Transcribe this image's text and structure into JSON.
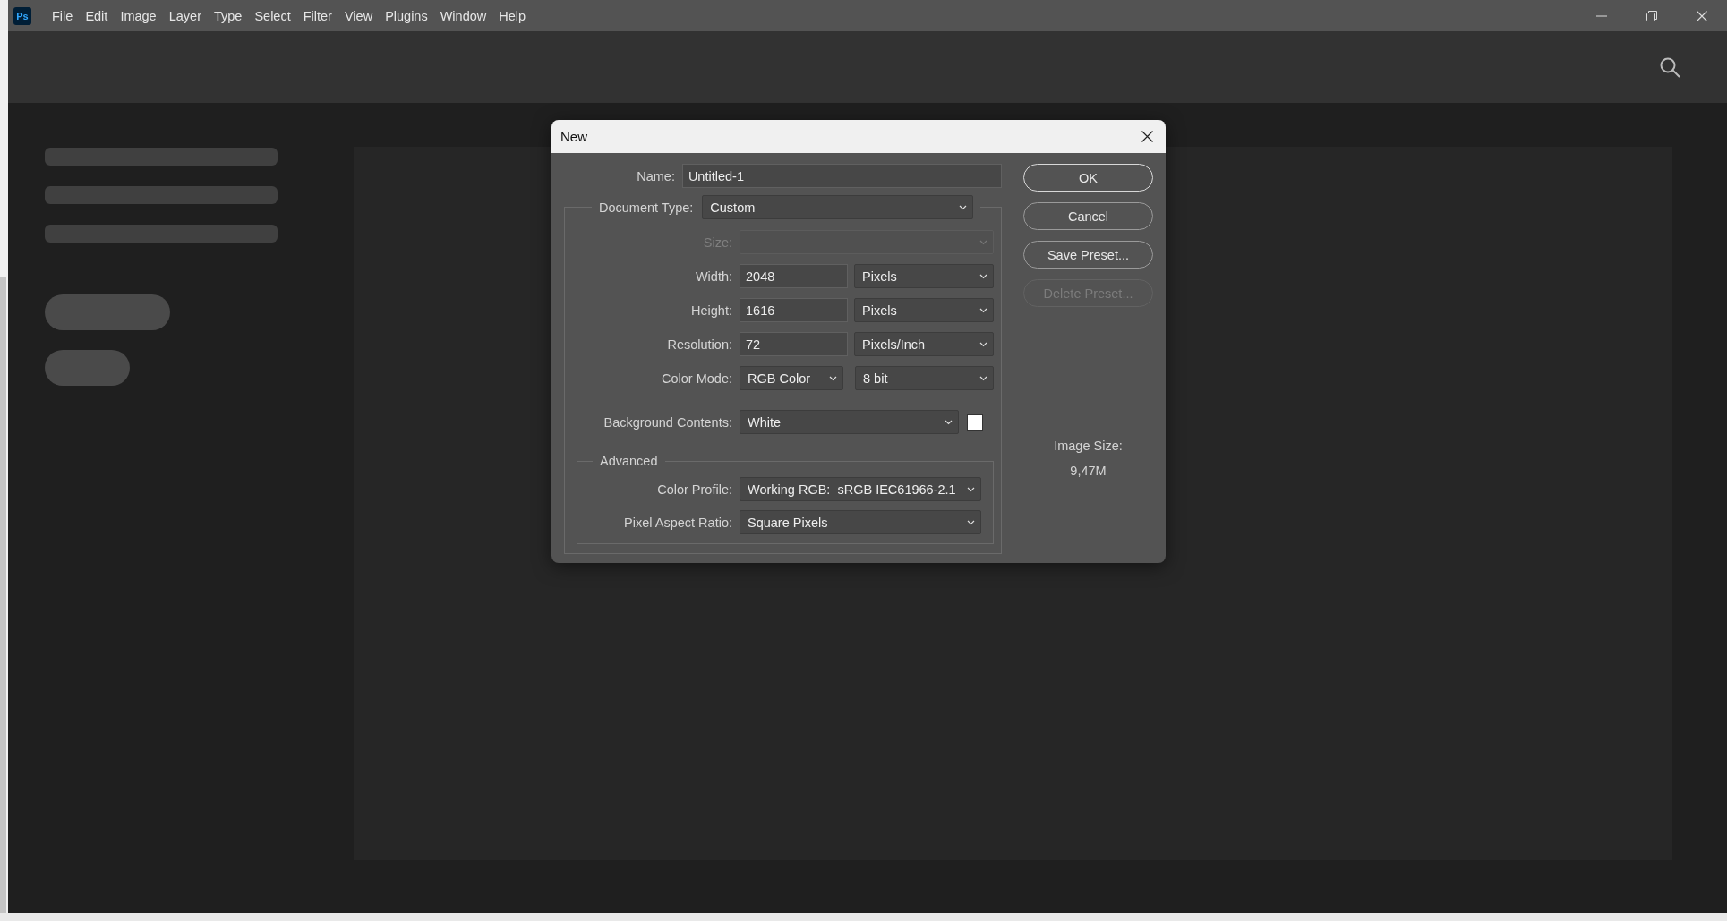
{
  "app": {
    "logo": "Ps",
    "menu": [
      "File",
      "Edit",
      "Image",
      "Layer",
      "Type",
      "Select",
      "Filter",
      "View",
      "Plugins",
      "Window",
      "Help"
    ]
  },
  "dialog": {
    "title": "New",
    "name": {
      "label": "Name:",
      "value": "Untitled-1"
    },
    "document_type": {
      "label": "Document Type:",
      "value": "Custom"
    },
    "rows": [
      {
        "kind": "select",
        "label": "Size:",
        "disabled": true
      },
      {
        "kind": "value_unit",
        "label": "Width:",
        "value": "2048",
        "unit": "Pixels",
        "disabled": false
      },
      {
        "kind": "value_unit",
        "label": "Height:",
        "value": "1616",
        "unit": "Pixels",
        "disabled": false
      },
      {
        "kind": "value_unit",
        "label": "Resolution:",
        "value": "72",
        "unit": "Pixels/Inch",
        "disabled": false
      },
      {
        "kind": "pair",
        "label": "Color Mode:",
        "value": "RGB Color",
        "unit": "8 bit",
        "disabled": false
      },
      {
        "kind": "swatch",
        "label": "Background Contents:",
        "value": "White",
        "color": "#ffffff",
        "disabled": false
      }
    ],
    "advanced": {
      "title": "Advanced",
      "rows": [
        {
          "kind": "select",
          "label": "Color Profile:",
          "value": "Working RGB:  sRGB IEC61966-2.1",
          "disabled": false
        },
        {
          "kind": "select",
          "label": "Pixel Aspect Ratio:",
          "value": "Square Pixels",
          "disabled": false
        }
      ]
    },
    "buttons": [
      {
        "label": "OK",
        "default": true,
        "disabled": false
      },
      {
        "label": "Cancel",
        "default": false,
        "disabled": false
      },
      {
        "label": "Save Preset...",
        "default": false,
        "disabled": false
      },
      {
        "label": "Delete Preset...",
        "default": false,
        "disabled": true
      }
    ],
    "image_size": {
      "label": "Image Size:",
      "value": "9,47M"
    }
  }
}
